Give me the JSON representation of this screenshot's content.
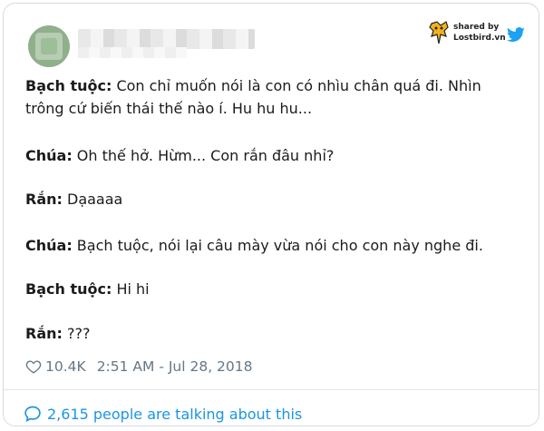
{
  "badge": {
    "line1": "shared by",
    "line2": "Lostbird.vn"
  },
  "tweet": {
    "lines": [
      {
        "speaker": "Bạch tuộc:",
        "text": " Con chỉ muốn nói là con có nhìu chân quá đi. Nhìn"
      },
      {
        "speaker": "",
        "text": "trông cứ biến thái thế nào í. Hu hu hu..."
      },
      {
        "speaker": "Chúa:",
        "text": " Oh thế hở. Hừm... Con rắn đâu nhỉ?"
      },
      {
        "speaker": "Rắn:",
        "text": " Dạaaaa"
      },
      {
        "speaker": "Chúa:",
        "text": " Bạch tuộc, nói lại câu mày vừa nói cho con này nghe đi."
      },
      {
        "speaker": "Bạch tuộc:",
        "text": " Hi hi"
      },
      {
        "speaker": "Rắn:",
        "text": " ???"
      }
    ]
  },
  "meta": {
    "likes": "10.4K",
    "timestamp": "2:51 AM - Jul 28, 2018"
  },
  "footer": {
    "talking": "2,615 people are talking about this"
  },
  "colors": {
    "link": "#1b95e0",
    "meta": "#657786",
    "twitter": "#1da1f2",
    "logo": "#f3b21b"
  },
  "icons": [
    "heart-icon",
    "comment-bubble-icon",
    "twitter-bird-icon",
    "lostbird-logo-icon"
  ]
}
